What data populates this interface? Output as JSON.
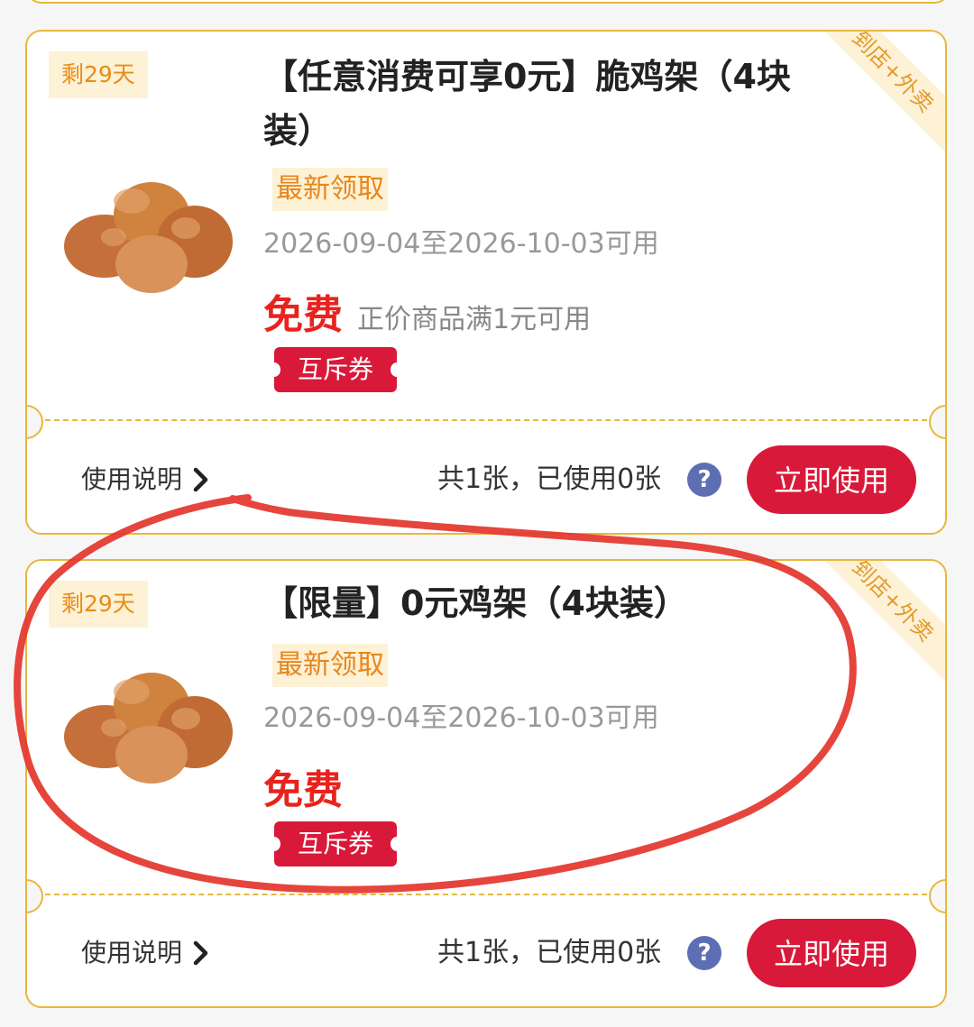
{
  "coupons": [
    {
      "days_left": "剩29天",
      "channel": "到店+外卖",
      "title": "【任意消费可享0元】脆鸡架（4块装）",
      "tag": "最新领取",
      "validity": "2026-09-04至2026-10-03可用",
      "price": "免费",
      "condition": "正价商品满1元可用",
      "ticket_label": "互斥券",
      "usage_link": "使用说明",
      "count_text": "共1张，已使用0张",
      "help": "?",
      "action": "立即使用"
    },
    {
      "days_left": "剩29天",
      "channel": "到店+外卖",
      "title": "【限量】0元鸡架（4块装）",
      "tag": "最新领取",
      "validity": "2026-09-04至2026-10-03可用",
      "price": "免费",
      "condition": "",
      "ticket_label": "互斥券",
      "usage_link": "使用说明",
      "count_text": "共1张，已使用0张",
      "help": "?",
      "action": "立即使用"
    }
  ],
  "colors": {
    "accent_red": "#d9193a",
    "price_red": "#e8231e",
    "border_gold": "#e8b73c",
    "tag_bg": "#fdf1d6",
    "tag_text": "#e8861a",
    "help_blue": "#5d6fb2",
    "annotation_red": "#e3352b"
  },
  "icons": [
    "chevron-right-icon",
    "question-icon",
    "fried-chicken-image"
  ]
}
